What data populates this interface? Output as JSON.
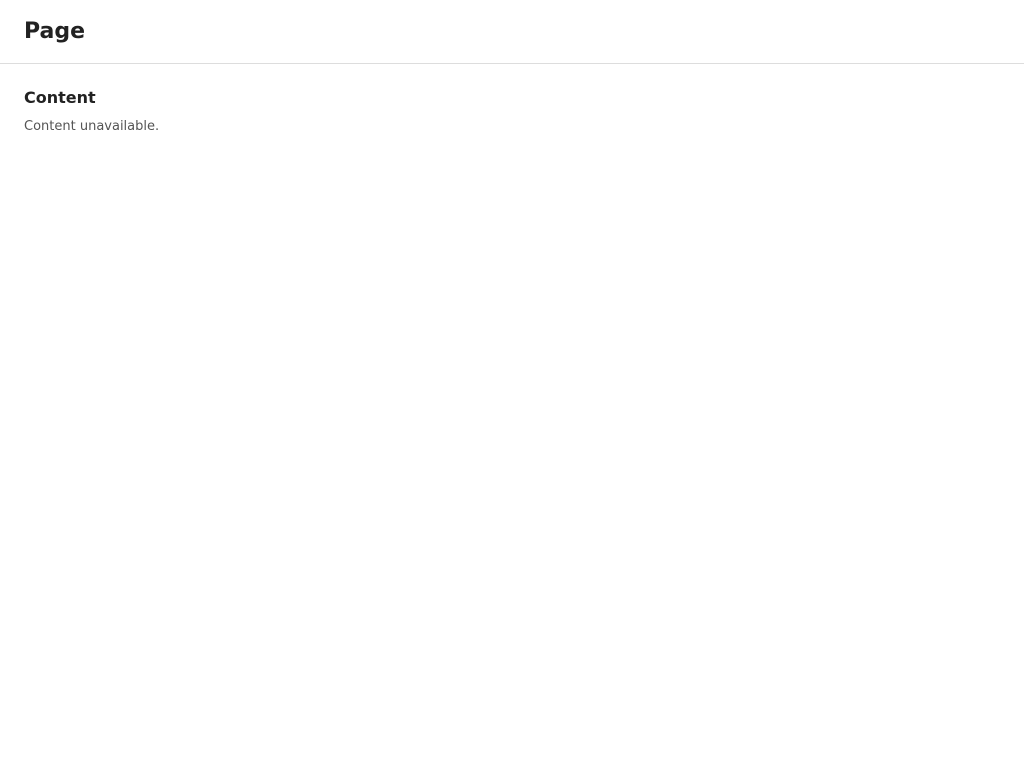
{
  "page": {
    "title": "Page"
  },
  "main": {
    "heading": "Content",
    "body": "Content unavailable."
  }
}
